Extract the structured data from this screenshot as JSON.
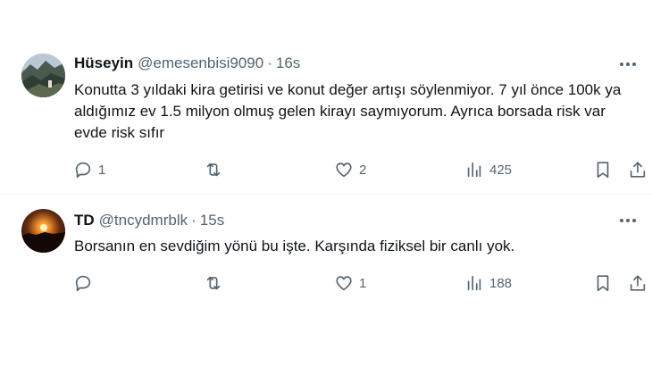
{
  "tweets": [
    {
      "name": "Hüseyin",
      "handle": "@emesenbisi9090",
      "separator": "·",
      "time": "16s",
      "text": "Konutta 3 yıldaki kira getirisi ve konut değer artışı söylenmiyor. 7 yıl önce 100k ya aldığımız ev 1.5 milyon olmuş gelen kirayı saymıyorum. Ayrıca borsada risk var evde risk sıfır",
      "replies": "1",
      "retweets": "",
      "likes": "2",
      "views": "425",
      "avatar_icon": "mountain-landscape-avatar"
    },
    {
      "name": "TD",
      "handle": "@tncydmrblk",
      "separator": "·",
      "time": "15s",
      "text": "Borsanın en sevdiğim yönü bu işte. Karşında fiziksel bir canlı yok.",
      "replies": "",
      "retweets": "",
      "likes": "1",
      "views": "188",
      "avatar_icon": "sunset-avatar"
    }
  ],
  "icons": {
    "reply": "reply-icon",
    "retweet": "retweet-icon",
    "like": "heart-icon",
    "views": "views-icon",
    "bookmark": "bookmark-icon",
    "share": "share-icon",
    "more": "more-icon"
  },
  "colors": {
    "text": "#0f1419",
    "secondary": "#536471",
    "divider": "#eff3f4"
  }
}
